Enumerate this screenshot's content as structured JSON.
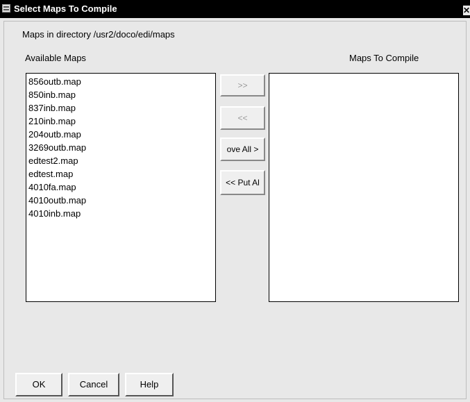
{
  "window": {
    "title": "Select Maps To Compile",
    "close_glyph": "✕"
  },
  "directory_label": "Maps in directory /usr2/doco/edi/maps",
  "available": {
    "label": "Available Maps",
    "items": [
      "856outb.map",
      "850inb.map",
      "837inb.map",
      "210inb.map",
      "204outb.map",
      "3269outb.map",
      "edtest2.map",
      "edtest.map",
      "4010fa.map",
      "4010outb.map",
      "4010inb.map"
    ]
  },
  "compile": {
    "label": "Maps To Compile",
    "items": []
  },
  "buttons": {
    "move_right": "&gt;&gt;",
    "move_left": "&lt;&lt;",
    "move_all": "ove All &gt;",
    "put_all": "&lt;&lt; Put Al"
  },
  "footer": {
    "ok": "OK",
    "cancel": "Cancel",
    "help": "Help"
  }
}
